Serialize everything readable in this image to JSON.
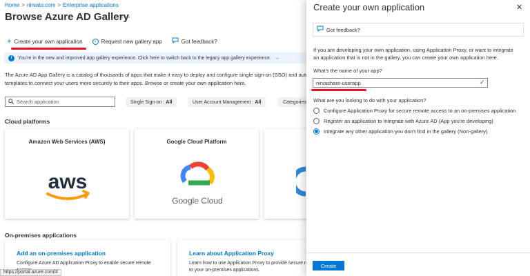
{
  "breadcrumb": {
    "home": "Home",
    "tenant": "nirvato.com",
    "section": "Enterprise applications",
    "sep": ">"
  },
  "page": {
    "title": "Browse Azure AD Gallery",
    "more": "···"
  },
  "toolbar": {
    "create_own": "Create your own application",
    "request_new": "Request new gallery app",
    "feedback": "Got feedback?"
  },
  "banner": {
    "text": "You're in the new and improved app gallery experience. Click here to switch back to the legacy app gallery experience.",
    "arrow": "→"
  },
  "description": {
    "line1": "The Azure AD App Gallery is a catalog of thousands of apps that make it easy to deploy and configure single sign-on (SSO) and autom",
    "line2": "templates to connect your users more securely to their apps. Browse or create your own application here."
  },
  "search": {
    "placeholder": "Search application"
  },
  "filters": [
    {
      "label": "Single Sign-on :",
      "value": "All"
    },
    {
      "label": "User Account Management :",
      "value": "All"
    },
    {
      "label": "Categories",
      "value": ""
    }
  ],
  "cloud": {
    "title": "Cloud platforms",
    "cards": [
      {
        "name": "Amazon Web Services (AWS)",
        "logo_text": "aws"
      },
      {
        "name": "Google Cloud Platform",
        "logo_text": "Google Cloud"
      }
    ]
  },
  "onprem": {
    "title": "On-premises applications",
    "cards": [
      {
        "title": "Add an on-premises application",
        "line1": "Configure Azure AD Application Proxy to enable secure remote",
        "line2": "access."
      },
      {
        "title": "Learn about Application Proxy",
        "line1": "Learn how to use Application Proxy to provide secure rem",
        "line2": "to your on-premises applications."
      }
    ]
  },
  "status_url": "https://portal.azure.com/#",
  "panel": {
    "title": "Create your own application",
    "close": "✕",
    "feedback": "Got feedback?",
    "intro": "If you are developing your own application, using Application Proxy, or want to integrate an application that is not in the gallery, you can create your own application here.",
    "name_label": "What's the name of your app?",
    "name_value": "nirvashare-userapp",
    "question": "What are you looking to do with your application?",
    "options": [
      {
        "label": "Configure Application Proxy for secure remote access to an on-premises application",
        "selected": false
      },
      {
        "label": "Register an application to integrate with Azure AD (App you're developing)",
        "selected": false
      },
      {
        "label": "Integrate any other application you don't find in the gallery (Non-gallery)",
        "selected": true
      }
    ],
    "create_label": "Create"
  },
  "colors": {
    "accent": "#0078d4",
    "annotation": "#e81123",
    "banner_bg": "#ebf3fc"
  },
  "icons": [
    "plus-icon",
    "info-icon",
    "feedback-icon",
    "search-icon",
    "close-icon",
    "check-icon"
  ]
}
